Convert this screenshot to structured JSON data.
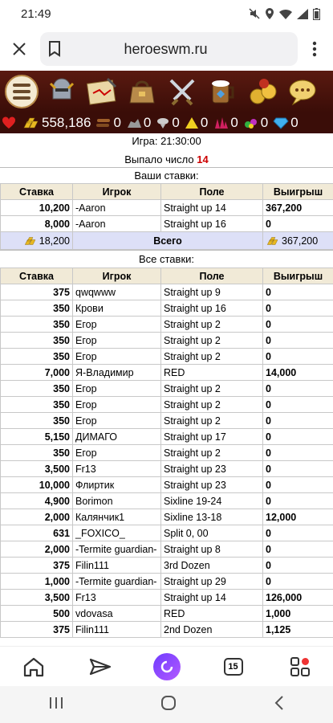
{
  "status": {
    "time": "21:49"
  },
  "browser": {
    "url": "heroeswm.ru"
  },
  "nav_icons": [
    "hero-icon",
    "map-icon",
    "inventory-icon",
    "battles-icon",
    "tavern-icon",
    "roulette-icon",
    "chat-icon"
  ],
  "resources": [
    {
      "icon": "heart-icon",
      "value": ""
    },
    {
      "icon": "gold-icon",
      "value": "558,186"
    },
    {
      "icon": "wood-icon",
      "value": "0"
    },
    {
      "icon": "ore-icon",
      "value": "0"
    },
    {
      "icon": "mercury-icon",
      "value": "0"
    },
    {
      "icon": "sulfur-icon",
      "value": "0"
    },
    {
      "icon": "crystal-icon",
      "value": "0"
    },
    {
      "icon": "gems-icon",
      "value": "0"
    },
    {
      "icon": "diamond-icon",
      "value": "0"
    }
  ],
  "game": {
    "line": "Игра: 21:30:00",
    "won_prefix": "Выпало число",
    "won_number": "14"
  },
  "your_bets": {
    "title": "Ваши ставки:",
    "headers": [
      "Ставка",
      "Игрок",
      "Поле",
      "Выигрыш"
    ],
    "rows": [
      {
        "bet": "10,200",
        "player": "-Aaron",
        "field": "Straight up 14",
        "win": "367,200"
      },
      {
        "bet": "8,000",
        "player": "-Aaron",
        "field": "Straight up 16",
        "win": "0"
      }
    ],
    "total": {
      "bet": "18,200",
      "label": "Всего",
      "win": "367,200"
    }
  },
  "all_bets": {
    "title": "Все ставки:",
    "headers": [
      "Ставка",
      "Игрок",
      "Поле",
      "Выигрыш"
    ],
    "rows": [
      {
        "bet": "375",
        "player": "qwqwww",
        "field": "Straight up 9",
        "win": "0"
      },
      {
        "bet": "350",
        "player": "Крови",
        "field": "Straight up 16",
        "win": "0"
      },
      {
        "bet": "350",
        "player": "Егор",
        "field": "Straight up 2",
        "win": "0"
      },
      {
        "bet": "350",
        "player": "Егор",
        "field": "Straight up 2",
        "win": "0"
      },
      {
        "bet": "350",
        "player": "Егор",
        "field": "Straight up 2",
        "win": "0"
      },
      {
        "bet": "7,000",
        "player": "Я-Владимир",
        "field": "RED",
        "win": "14,000"
      },
      {
        "bet": "350",
        "player": "Егор",
        "field": "Straight up 2",
        "win": "0"
      },
      {
        "bet": "350",
        "player": "Егор",
        "field": "Straight up 2",
        "win": "0"
      },
      {
        "bet": "350",
        "player": "Егор",
        "field": "Straight up 2",
        "win": "0"
      },
      {
        "bet": "5,150",
        "player": "ДИМАГО",
        "field": "Straight up 17",
        "win": "0"
      },
      {
        "bet": "350",
        "player": "Егор",
        "field": "Straight up 2",
        "win": "0"
      },
      {
        "bet": "3,500",
        "player": "Fr13",
        "field": "Straight up 23",
        "win": "0"
      },
      {
        "bet": "10,000",
        "player": "Флиртик",
        "field": "Straight up 23",
        "win": "0"
      },
      {
        "bet": "4,900",
        "player": "Borimon",
        "field": "Sixline 19-24",
        "win": "0"
      },
      {
        "bet": "2,000",
        "player": "Калянчик1",
        "field": "Sixline 13-18",
        "win": "12,000"
      },
      {
        "bet": "631",
        "player": "_FOXICO_",
        "field": "Split 0, 00",
        "win": "0"
      },
      {
        "bet": "2,000",
        "player": "-Termite guardian-",
        "field": "Straight up 8",
        "win": "0"
      },
      {
        "bet": "375",
        "player": "Filin111",
        "field": "3rd Dozen",
        "win": "0"
      },
      {
        "bet": "1,000",
        "player": "-Termite guardian-",
        "field": "Straight up 29",
        "win": "0"
      },
      {
        "bet": "3,500",
        "player": "Fr13",
        "field": "Straight up 14",
        "win": "126,000"
      },
      {
        "bet": "500",
        "player": "vdovasa",
        "field": "RED",
        "win": "1,000"
      },
      {
        "bet": "375",
        "player": "Filin111",
        "field": "2nd Dozen",
        "win": "1,125"
      }
    ]
  },
  "bottom_nav": {
    "tabs_count": "15"
  }
}
